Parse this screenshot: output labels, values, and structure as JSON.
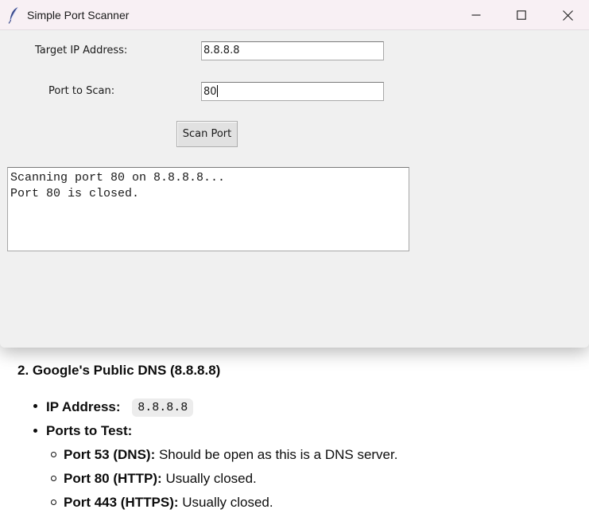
{
  "window": {
    "title": "Simple Port Scanner",
    "title_icon": "feather-icon"
  },
  "form": {
    "ip_label": "Target IP Address:",
    "ip_value": "8.8.8.8",
    "port_label": "Port to Scan:",
    "port_value": "80",
    "scan_button": "Scan Port"
  },
  "output": {
    "lines": [
      "Scanning port 80 on 8.8.8.8...",
      "Port 80 is closed."
    ]
  },
  "doc": {
    "heading": "2. Google's Public DNS (8.8.8.8)",
    "ip_label": "IP Address:",
    "ip_code": "8.8.8.8",
    "ports_label": "Ports to Test:",
    "ports": [
      {
        "label": "Port 53 (DNS):",
        "desc": " Should be open as this is a DNS server."
      },
      {
        "label": "Port 80 (HTTP):",
        "desc": " Usually closed."
      },
      {
        "label": "Port 443 (HTTPS):",
        "desc": " Usually closed."
      }
    ]
  }
}
